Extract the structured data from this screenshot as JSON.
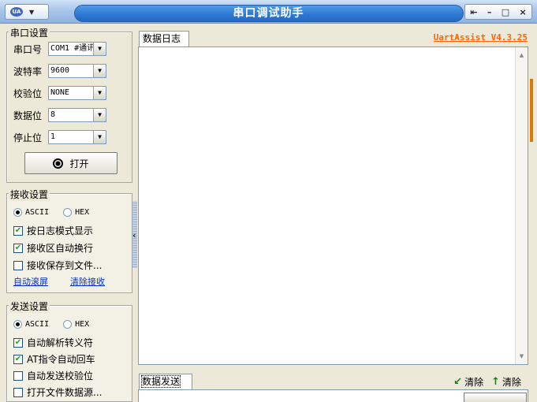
{
  "window": {
    "title": "串口调试助手",
    "logo": "UA",
    "controls": [
      "⇤",
      "–",
      "□",
      "×"
    ]
  },
  "serial": {
    "legend": "串口设置",
    "port_label": "串口号",
    "port_value": "COM1 #通讯",
    "baud_label": "波特率",
    "baud_value": "9600",
    "parity_label": "校验位",
    "parity_value": "NONE",
    "databits_label": "数据位",
    "databits_value": "8",
    "stopbits_label": "停止位",
    "stopbits_value": "1",
    "open_label": "打开"
  },
  "receive": {
    "legend": "接收设置",
    "ascii": "ASCII",
    "hex": "HEX",
    "opt1": "按日志模式显示",
    "opt2": "接收区自动换行",
    "opt3": "接收保存到文件...",
    "link1": "自动滚屏",
    "link2": "清除接收"
  },
  "send": {
    "legend": "发送设置",
    "ascii": "ASCII",
    "hex": "HEX",
    "opt1": "自动解析转义符",
    "opt2": "AT指令自动回车",
    "opt3": "自动发送校验位",
    "opt4": "打开文件数据源..."
  },
  "log": {
    "tab": "数据日志",
    "version": "UartAssist V4.3.25"
  },
  "send_area": {
    "tab": "数据发送",
    "clear1": "清除",
    "clear2": "清除"
  }
}
